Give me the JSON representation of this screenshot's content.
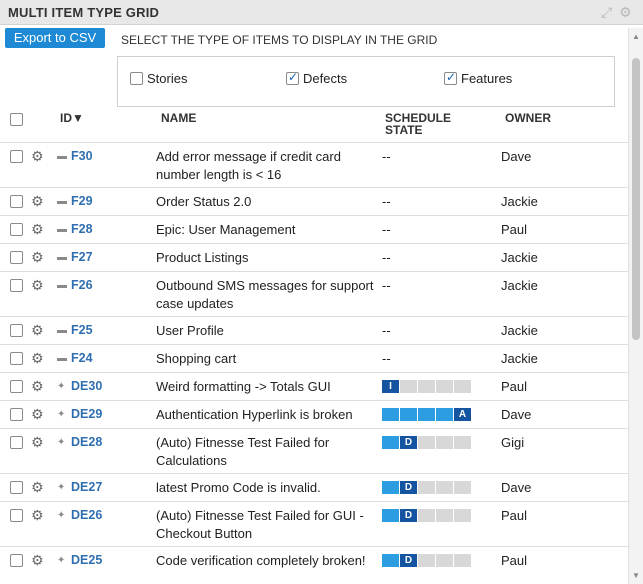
{
  "panel": {
    "title": "MULTI ITEM TYPE GRID",
    "icons": [
      "expand-icon",
      "gear-icon"
    ]
  },
  "toolbar": {
    "export_label": "Export to CSV",
    "select_label": "SELECT THE TYPE OF ITEMS TO DISPLAY IN THE GRID"
  },
  "type_filters": [
    {
      "label": "Stories",
      "checked": false
    },
    {
      "label": "Defects",
      "checked": true
    },
    {
      "label": "Features",
      "checked": true
    }
  ],
  "columns": {
    "id": "ID",
    "sort_indicator": "▼",
    "name": "NAME",
    "schedule_state_line1": "SCHEDULE",
    "schedule_state_line2": "STATE",
    "owner": "OWNER"
  },
  "rows": [
    {
      "type": "feature",
      "id": "F30",
      "name": "Add error message if credit card number length is < 16",
      "state": "--",
      "owner": "Dave"
    },
    {
      "type": "feature",
      "id": "F29",
      "name": "Order Status 2.0",
      "state": "--",
      "owner": "Jackie"
    },
    {
      "type": "feature",
      "id": "F28",
      "name": "Epic: User Management",
      "state": "--",
      "owner": "Paul"
    },
    {
      "type": "feature",
      "id": "F27",
      "name": "Product Listings",
      "state": "--",
      "owner": "Jackie"
    },
    {
      "type": "feature",
      "id": "F26",
      "name": "Outbound SMS messages for support case updates",
      "state": "--",
      "owner": "Jackie"
    },
    {
      "type": "feature",
      "id": "F25",
      "name": "User Profile",
      "state": "--",
      "owner": "Jackie"
    },
    {
      "type": "feature",
      "id": "F24",
      "name": "Shopping cart",
      "state": "--",
      "owner": "Jackie"
    },
    {
      "type": "defect",
      "id": "DE30",
      "name": "Weird formatting -> Totals GUI",
      "state_letter": "I",
      "state_index": 0,
      "owner": "Paul"
    },
    {
      "type": "defect",
      "id": "DE29",
      "name": "Authentication Hyperlink is broken",
      "state_letter": "A",
      "state_index": 4,
      "owner": "Dave"
    },
    {
      "type": "defect",
      "id": "DE28",
      "name": "(Auto) Fitnesse Test Failed for Calculations",
      "state_letter": "D",
      "state_index": 1,
      "owner": "Gigi"
    },
    {
      "type": "defect",
      "id": "DE27",
      "name": "latest Promo Code is invalid.",
      "state_letter": "D",
      "state_index": 1,
      "owner": "Dave"
    },
    {
      "type": "defect",
      "id": "DE26",
      "name": "(Auto) Fitnesse Test Failed for GUI - Checkout Button",
      "state_letter": "D",
      "state_index": 1,
      "owner": "Paul"
    },
    {
      "type": "defect",
      "id": "DE25",
      "name": "Code verification completely broken!",
      "state_letter": "D",
      "state_index": 1,
      "owner": "Paul"
    }
  ],
  "schedule_state_segments": 5,
  "colors": {
    "accent": "#1e8ad6",
    "id_link": "#2f6fb0",
    "state_done": "#2b9de0",
    "state_current": "#1454a0",
    "state_todo": "#d8d8d8"
  }
}
